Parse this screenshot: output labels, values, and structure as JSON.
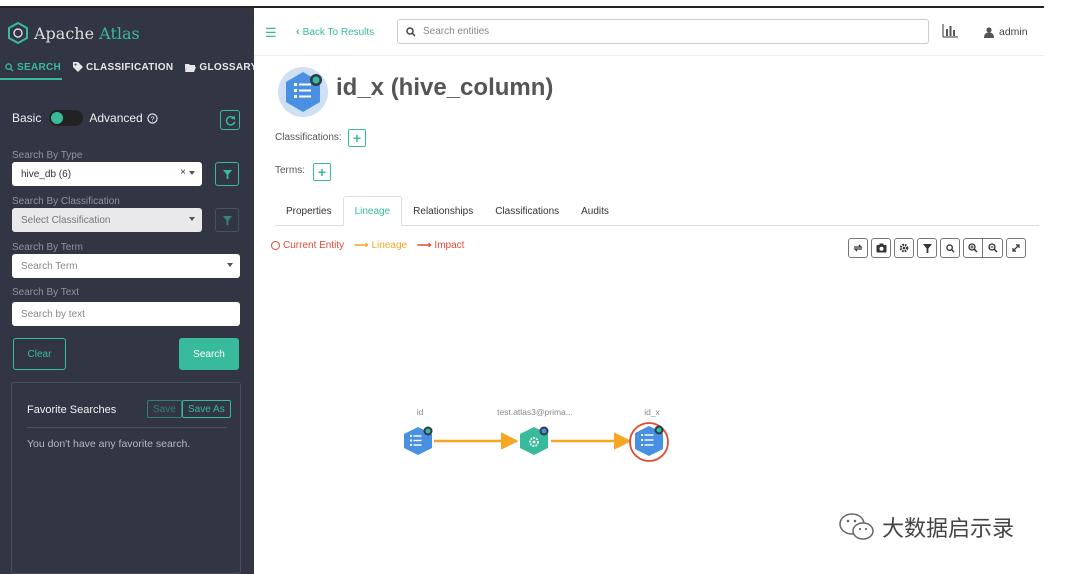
{
  "brand": {
    "name_prefix": "Apache",
    "name_suffix": "Atlas"
  },
  "nav": {
    "tabs": [
      {
        "label": "SEARCH",
        "icon": "search-icon",
        "active": true
      },
      {
        "label": "CLASSIFICATION",
        "icon": "tag-icon",
        "active": false
      },
      {
        "label": "GLOSSARY",
        "icon": "folder-open-icon",
        "active": false
      }
    ]
  },
  "sidebar": {
    "basic_label": "Basic",
    "advanced_label": "Advanced",
    "advanced_icon": "question-circle-icon",
    "refresh_icon": "refresh-icon",
    "search_by_type_label": "Search By Type",
    "type_value": "hive_db (6)",
    "search_by_classification_label": "Search By Classification",
    "classification_placeholder": "Select Classification",
    "search_by_term_label": "Search By Term",
    "term_placeholder": "Search Term",
    "search_by_text_label": "Search By Text",
    "text_placeholder": "Search by text",
    "clear_label": "Clear",
    "search_label": "Search",
    "favorites": {
      "title": "Favorite Searches",
      "save_label": "Save",
      "save_as_label": "Save As",
      "empty_text": "You don't have any favorite search."
    }
  },
  "header": {
    "back_label": "Back To Results",
    "search_placeholder": "Search entities",
    "stats_icon": "bar-chart-icon",
    "user_label": "admin",
    "user_icon": "user-icon"
  },
  "entity": {
    "title": "id_x (hive_column)",
    "classifications_label": "Classifications:",
    "terms_label": "Terms:"
  },
  "tabs": [
    "Properties",
    "Lineage",
    "Relationships",
    "Classifications",
    "Audits"
  ],
  "active_tab": "Lineage",
  "legend": {
    "current_entity": "Current Entity",
    "lineage": "Lineage",
    "impact": "Impact"
  },
  "toolbar": {
    "icons": [
      "refresh-icon",
      "camera-icon",
      "gear-icon",
      "filter-icon",
      "search-icon",
      "zoom-in-icon",
      "zoom-out-icon",
      "fullscreen-icon"
    ]
  },
  "lineage": {
    "nodes": [
      {
        "label": "id",
        "kind": "column"
      },
      {
        "label": "test.atlas3@prima...",
        "kind": "process"
      },
      {
        "label": "id_x",
        "kind": "column",
        "current": true
      }
    ]
  },
  "watermark": "大数据启示录",
  "colors": {
    "accent": "#38bb9b",
    "sidebar_bg": "#323544",
    "lineage_edge": "#f5a623",
    "impact": "#e24a33",
    "node_blue": "#4a90e2"
  }
}
